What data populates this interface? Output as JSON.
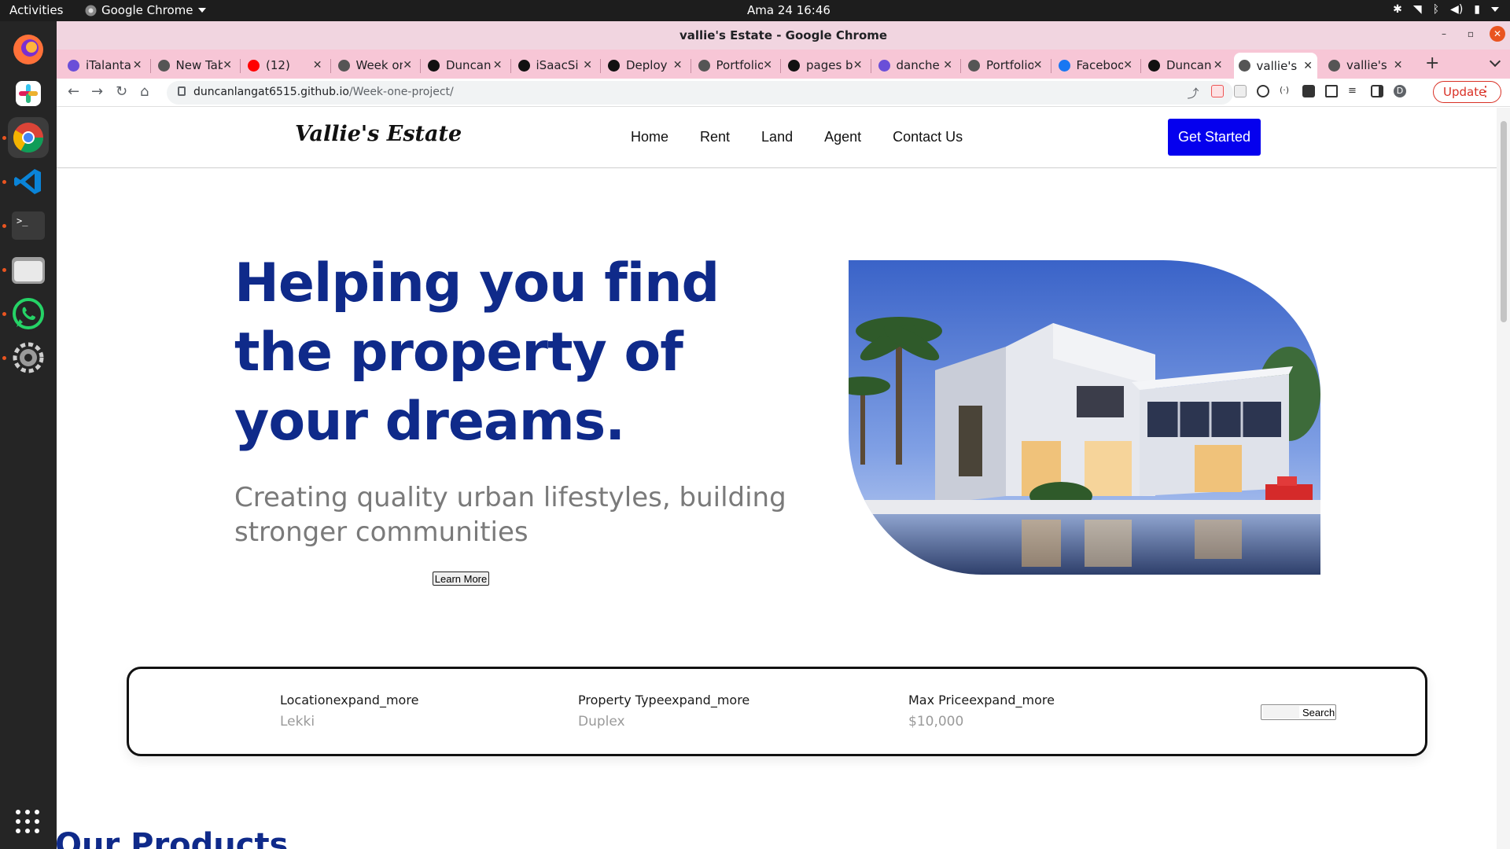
{
  "system": {
    "activities": "Activities",
    "app_name": "Google Chrome",
    "clock": "Ama 24  16:46"
  },
  "window": {
    "title": "vallie's Estate - Google Chrome"
  },
  "tabs": [
    {
      "label": "iTalanta",
      "icon": "document-icon",
      "color": "#6a4fd8"
    },
    {
      "label": "New Tab",
      "icon": "chrome-icon",
      "color": "#555555"
    },
    {
      "label": "(12)",
      "icon": "youtube-icon",
      "color": "#ff0000"
    },
    {
      "label": "Week one",
      "icon": "globe-icon",
      "color": "#555555"
    },
    {
      "label": "Duncan",
      "icon": "github-icon",
      "color": "#111111"
    },
    {
      "label": "iSaacSi",
      "icon": "github-icon",
      "color": "#111111"
    },
    {
      "label": "Deploy",
      "icon": "github-icon",
      "color": "#111111"
    },
    {
      "label": "Portfolio",
      "icon": "globe-icon",
      "color": "#555555"
    },
    {
      "label": "pages b",
      "icon": "github-icon",
      "color": "#111111"
    },
    {
      "label": "danche",
      "icon": "hashnode-icon",
      "color": "#6a4fd8"
    },
    {
      "label": "Portfolio",
      "icon": "globe-icon",
      "color": "#555555"
    },
    {
      "label": "Facebook",
      "icon": "facebook-icon",
      "color": "#1877f2"
    },
    {
      "label": "Duncan",
      "icon": "github-icon",
      "color": "#111111"
    },
    {
      "label": "vallie's",
      "icon": "globe-icon",
      "color": "#555555",
      "active": true
    },
    {
      "label": "vallie's",
      "icon": "globe-icon",
      "color": "#555555"
    }
  ],
  "toolbar": {
    "url_host": "duncanlangat6515.github.io",
    "url_path": "/Week-one-project/",
    "update_label": "Update",
    "profile_initial": "D"
  },
  "site": {
    "brand": "Vallie's Estate",
    "nav": [
      "Home",
      "Rent",
      "Land",
      "Agent",
      "Contact Us"
    ],
    "cta": "Get Started",
    "hero_title": "Helping you find the property of your dreams.",
    "hero_subtitle": "Creating quality urban lifestyles, building stronger communities",
    "learn_more": "Learn More",
    "search": {
      "location_label": "Locationexpand_more",
      "location_value": "Lekki",
      "type_label": "Property Typeexpand_more",
      "type_value": "Duplex",
      "price_label": "Max Priceexpand_more",
      "price_value": "$10,000",
      "button": "Search"
    },
    "products_title": "Our Products"
  },
  "colors": {
    "brand_blue": "#0f2a8a",
    "cta_blue": "#0500ee",
    "tab_strip": "#f7c6d6"
  }
}
